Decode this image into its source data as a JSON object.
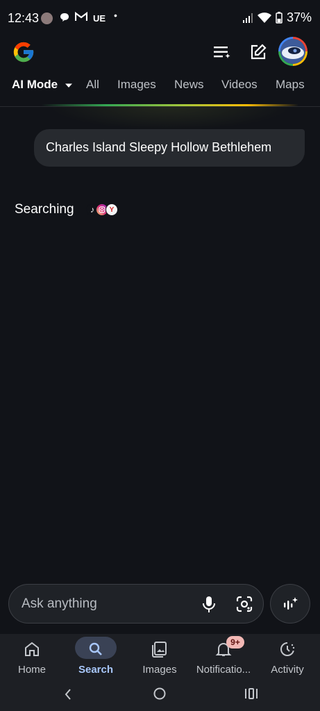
{
  "status_bar": {
    "time": "12:43",
    "carrier_tag": "UE",
    "battery": "37%"
  },
  "tabs": [
    {
      "label": "AI Mode",
      "active": true
    },
    {
      "label": "All",
      "active": false
    },
    {
      "label": "Images",
      "active": false
    },
    {
      "label": "News",
      "active": false
    },
    {
      "label": "Videos",
      "active": false
    },
    {
      "label": "Maps",
      "active": false
    }
  ],
  "query": "Charles Island Sleepy Hollow Bethlehem",
  "status_text": "Searching",
  "source_icons": [
    "tiktok-icon",
    "instagram-icon",
    "yelp-icon"
  ],
  "ask_bar": {
    "placeholder": "Ask anything"
  },
  "bottom_nav": [
    {
      "label": "Home",
      "icon": "home-icon",
      "active": false
    },
    {
      "label": "Search",
      "icon": "search-icon",
      "active": true
    },
    {
      "label": "Images",
      "icon": "images-icon",
      "active": false
    },
    {
      "label": "Notificatio...",
      "icon": "bell-icon",
      "active": false,
      "badge": "9+"
    },
    {
      "label": "Activity",
      "icon": "activity-icon",
      "active": false
    }
  ],
  "colors": {
    "background": "#111318",
    "accent": "#a8c7fa",
    "badge": "#f2b8b5"
  }
}
